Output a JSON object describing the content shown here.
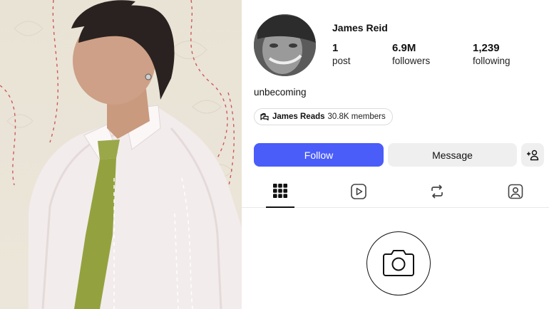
{
  "profile": {
    "username": "James Reid",
    "stats": {
      "posts_count": "1",
      "posts_label": "post",
      "followers_count": "6.9M",
      "followers_label": "followers",
      "following_count": "1,239",
      "following_label": "following"
    },
    "bio": "unbecoming",
    "channel": {
      "icon": "broadcast-channel-icon",
      "name": "James Reads",
      "members": "30.8K members"
    }
  },
  "actions": {
    "follow_label": "Follow",
    "message_label": "Message",
    "add_icon": "add-person-icon"
  },
  "tabs": [
    {
      "icon": "grid-icon",
      "active": true
    },
    {
      "icon": "reels-icon",
      "active": false
    },
    {
      "icon": "reposts-icon",
      "active": false
    },
    {
      "icon": "tagged-icon",
      "active": false
    }
  ],
  "empty_state": {
    "icon": "camera-icon"
  },
  "colors": {
    "follow_button": "#4a5df9",
    "secondary_button": "#efefef",
    "text": "#111111"
  }
}
